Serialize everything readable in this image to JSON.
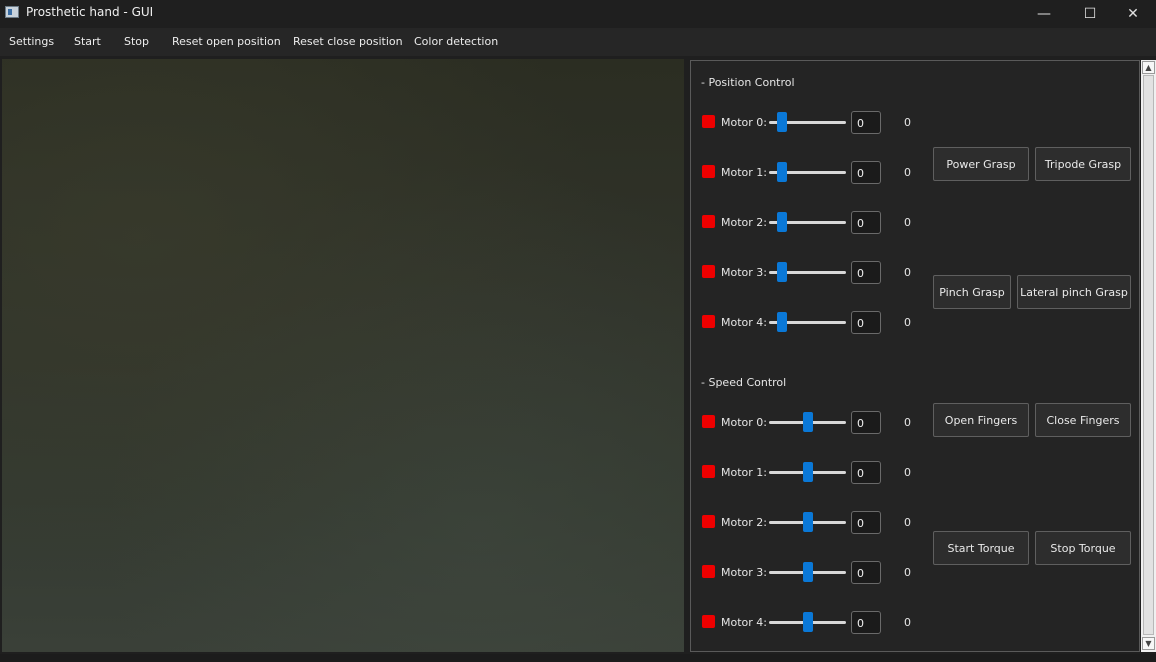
{
  "window": {
    "title": "Prosthetic hand - GUI",
    "minimize_glyph": "—",
    "maximize_glyph": "☐",
    "close_glyph": "✕"
  },
  "menu": [
    {
      "label": "Settings"
    },
    {
      "label": "Start"
    },
    {
      "label": "Stop"
    },
    {
      "label": "Reset open position"
    },
    {
      "label": "Reset close position"
    },
    {
      "label": "Color detection"
    }
  ],
  "position_control": {
    "title": "- Position Control",
    "motors": [
      {
        "label": "Motor 0:",
        "spin_value": "0",
        "value": "0",
        "slider_level": 0.17
      },
      {
        "label": "Motor 1:",
        "spin_value": "0",
        "value": "0",
        "slider_level": 0.17
      },
      {
        "label": "Motor 2:",
        "spin_value": "0",
        "value": "0",
        "slider_level": 0.17
      },
      {
        "label": "Motor 3:",
        "spin_value": "0",
        "value": "0",
        "slider_level": 0.17
      },
      {
        "label": "Motor 4:",
        "spin_value": "0",
        "value": "0",
        "slider_level": 0.17
      }
    ]
  },
  "speed_control": {
    "title": "- Speed Control",
    "motors": [
      {
        "label": "Motor 0:",
        "spin_value": "0",
        "value": "0",
        "slider_level": 0.5
      },
      {
        "label": "Motor 1:",
        "spin_value": "0",
        "value": "0",
        "slider_level": 0.5
      },
      {
        "label": "Motor 2:",
        "spin_value": "0",
        "value": "0",
        "slider_level": 0.5
      },
      {
        "label": "Motor 3:",
        "spin_value": "0",
        "value": "0",
        "slider_level": 0.5
      },
      {
        "label": "Motor 4:",
        "spin_value": "0",
        "value": "0",
        "slider_level": 0.5
      }
    ]
  },
  "buttons": {
    "power_grasp": "Power Grasp",
    "tripode_grasp": "Tripode Grasp",
    "pinch_grasp": "Pinch Grasp",
    "lateral_pinch_grasp": "Lateral pinch Grasp",
    "open_fingers": "Open Fingers",
    "close_fingers": "Close Fingers",
    "start_torque": "Start Torque",
    "stop_torque": "Stop Torque"
  },
  "scrollbar": {
    "up_glyph": "▲",
    "down_glyph": "▼"
  },
  "colors": {
    "motor_status": "#ee0000",
    "slider_handle": "#0a78d7"
  }
}
